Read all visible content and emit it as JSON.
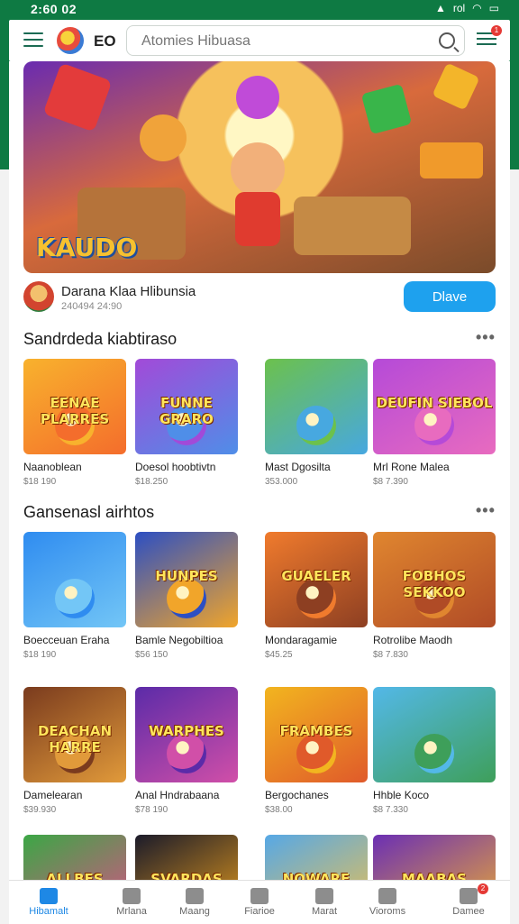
{
  "status": {
    "time": "2:60 02",
    "carrier": "rol"
  },
  "header": {
    "app_title": "EO",
    "search_placeholder": "Atomies Hibuasa",
    "cart_badge": "1"
  },
  "featured": {
    "banner_logo": "KAUDO",
    "title": "Darana Klaa Hlibunsia",
    "subtitle": "240494 24:90",
    "play_label": "Dlave"
  },
  "sections": [
    {
      "title": "Sandrdeda kiabtiraso",
      "more": "•••",
      "games": [
        {
          "name": "Naanoblean",
          "price": "$18 190",
          "art_text": "EENAE PLARRES",
          "bg": "#f8b22d",
          "bg2": "#f46d2c"
        },
        {
          "name": "Doesol hoobtivtn",
          "price": "$18.250",
          "art_text": "FUNNE GRARO",
          "bg": "#a24ad8",
          "bg2": "#4f8ee8"
        },
        {
          "name": "Mast Dgosilta",
          "price": "353.000",
          "art_text": "",
          "bg": "#6cc14c",
          "bg2": "#47a8e0"
        },
        {
          "name": "Mrl Rone Malea",
          "price": "$8 7.390",
          "art_text": "DEUFIN SIEBOL",
          "bg": "#b54ad8",
          "bg2": "#e86bbf"
        }
      ]
    },
    {
      "title": "Gansenasl airhtos",
      "more": "•••",
      "games": [
        {
          "name": "Boecceuan Eraha",
          "price": "$18 190",
          "art_text": "",
          "bg": "#2f8cf0",
          "bg2": "#73c6f6"
        },
        {
          "name": "Bamle Negobiltioa",
          "price": "$56 150",
          "art_text": "HUNPES",
          "bg": "#2c4fc3",
          "bg2": "#f1a52a"
        },
        {
          "name": "Mondaragamie",
          "price": "$45.25",
          "art_text": "GUAELER",
          "bg": "#f07b2d",
          "bg2": "#8d3f22"
        },
        {
          "name": "Rotrolibe Maodh",
          "price": "$8 7.830",
          "art_text": "FOBHOS SEKKOO",
          "bg": "#e0862f",
          "bg2": "#b04b26"
        }
      ]
    },
    {
      "title": "",
      "more": "",
      "games": [
        {
          "name": "Damelearan",
          "price": "$39.930",
          "art_text": "DEACHAN HARRE",
          "bg": "#7a3b1e",
          "bg2": "#e19a3a"
        },
        {
          "name": "Anal Hndrabaana",
          "price": "$78 190",
          "art_text": "WARPHES",
          "bg": "#5b2ba8",
          "bg2": "#d14fa8"
        },
        {
          "name": "Bergochanes",
          "price": "$38.00",
          "art_text": "FRAMBES",
          "bg": "#f2b51f",
          "bg2": "#e05a2a"
        },
        {
          "name": "Hhble Koco",
          "price": "$8 7.330",
          "art_text": "",
          "bg": "#53b8e8",
          "bg2": "#3e9f5a"
        }
      ]
    },
    {
      "title": "",
      "more": "",
      "games": [
        {
          "name": "",
          "price": "",
          "art_text": "ALLBES",
          "bg": "#3ba745",
          "bg2": "#e44a8c"
        },
        {
          "name": "",
          "price": "",
          "art_text": "SVARDAS",
          "bg": "#1b1b2a",
          "bg2": "#f0a21c"
        },
        {
          "name": "",
          "price": "",
          "art_text": "NOWARE",
          "bg": "#56a8e6",
          "bg2": "#f3c24a"
        },
        {
          "name": "",
          "price": "",
          "art_text": "MAABAS",
          "bg": "#6b2fb4",
          "bg2": "#f2b12d"
        }
      ]
    }
  ],
  "bottom_nav": [
    {
      "label": "Hibamalt",
      "icon": "home-icon",
      "active": true
    },
    {
      "label": "Mrlana",
      "icon": "store-icon",
      "active": false
    },
    {
      "label": "Maang",
      "icon": "search-icon",
      "active": false
    },
    {
      "label": "Fiarioe",
      "icon": "list-icon",
      "active": false
    },
    {
      "label": "Marat",
      "icon": "bell-icon",
      "active": false
    },
    {
      "label": "Vioroms",
      "icon": "bookmark-icon",
      "active": false
    },
    {
      "label": "Damee",
      "icon": "profile-icon",
      "active": false,
      "badge": "2"
    }
  ],
  "colors": {
    "brand_green": "#0e7a43",
    "accent_blue": "#1ea1ee",
    "nav_active": "#1e88e5"
  }
}
